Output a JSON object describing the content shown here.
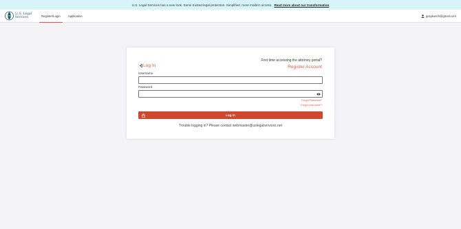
{
  "banner": {
    "text": "U.S. Legal Services has a new look. Same trusted legal protection. Simplified, more modern access.",
    "link": "Read more about our transformation"
  },
  "header": {
    "logo_line1": "U.S. Legal",
    "logo_line2": "Services",
    "tabs": [
      {
        "label": "Register/Login",
        "active": true
      },
      {
        "label": "Application",
        "active": false
      }
    ],
    "user_email": "gregkunch@gmail.com"
  },
  "login": {
    "title": "Log In",
    "first_time": "First time accessing the attorney portal?",
    "register_link": "Register Account",
    "username_label": "Username",
    "username_value": "",
    "password_label": "Password",
    "password_value": "",
    "forgot_password": "Forgot Password?",
    "forgot_username": "Forgot Username?",
    "button_label": "Log In",
    "trouble": "Trouble logging in? Please contact webmaster@uslegalservices.net"
  },
  "colors": {
    "accent": "#e05a47",
    "button": "#d2452f",
    "banner_bg": "#d7f5f8",
    "logo": "#1f5b69"
  },
  "icons": [
    "logo-mark-icon",
    "user-icon",
    "login-arrow-icon",
    "eye-icon",
    "lock-icon"
  ]
}
